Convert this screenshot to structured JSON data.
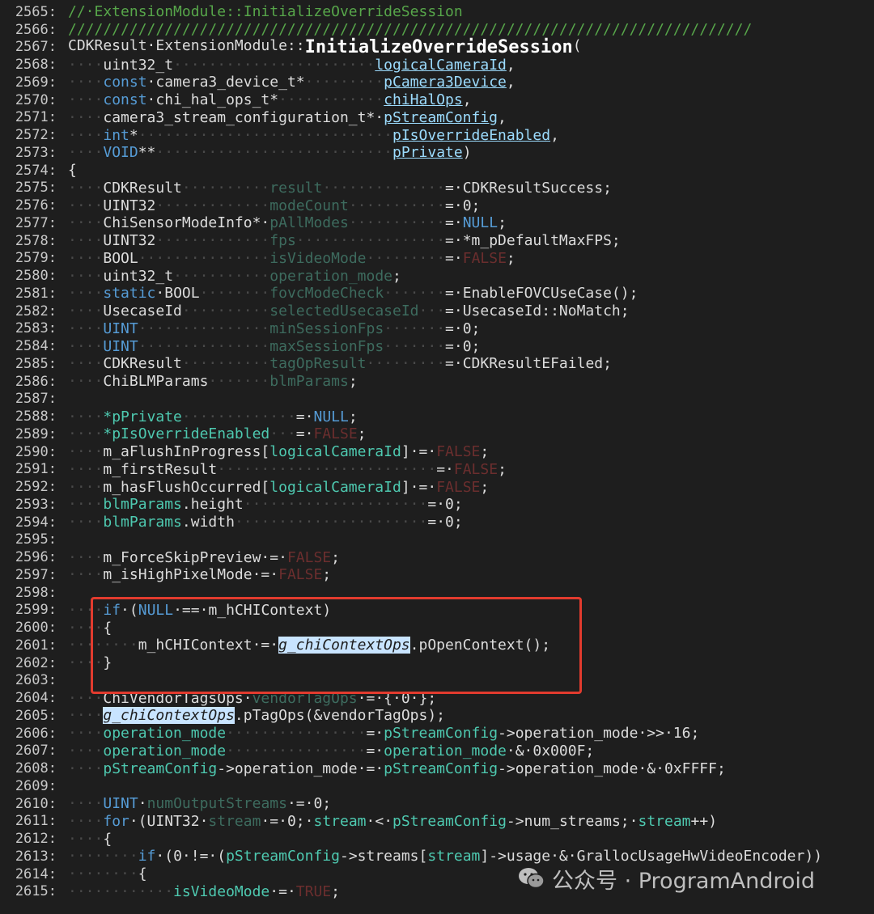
{
  "editor": {
    "lines": [
      {
        "n": "2565:",
        "tokens": [
          [
            "cm",
            "//·ExtensionModule::InitializeOverrideSession"
          ]
        ]
      },
      {
        "n": "2566:",
        "tokens": [
          [
            "cm",
            "//////////////////////////////////////////////////////////////////////////////"
          ]
        ]
      },
      {
        "n": "2567:",
        "tokens": [
          [
            "txt",
            "CDKResult·ExtensionModule::"
          ],
          [
            "fn",
            "InitializeOverrideSession"
          ],
          [
            "txt",
            "("
          ]
        ]
      },
      {
        "n": "2568:",
        "tokens": [
          [
            "ws",
            "····"
          ],
          [
            "ty",
            "uint32_t"
          ],
          [
            "ws",
            "·······················"
          ],
          [
            "param",
            "logicalCameraId"
          ],
          [
            "txt",
            ","
          ]
        ]
      },
      {
        "n": "2569:",
        "tokens": [
          [
            "ws",
            "····"
          ],
          [
            "kw",
            "const"
          ],
          [
            "txt",
            "·camera3_device_t*"
          ],
          [
            "ws",
            "·········"
          ],
          [
            "param",
            "pCamera3Device"
          ],
          [
            "txt",
            ","
          ]
        ]
      },
      {
        "n": "2570:",
        "tokens": [
          [
            "ws",
            "····"
          ],
          [
            "kw",
            "const"
          ],
          [
            "txt",
            "·chi_hal_ops_t*"
          ],
          [
            "ws",
            "············"
          ],
          [
            "param",
            "chiHalOps"
          ],
          [
            "txt",
            ","
          ]
        ]
      },
      {
        "n": "2571:",
        "tokens": [
          [
            "ws",
            "····"
          ],
          [
            "txt",
            "camera3_stream_configuration_t*·"
          ],
          [
            "param",
            "pStreamConfig"
          ],
          [
            "txt",
            ","
          ]
        ]
      },
      {
        "n": "2572:",
        "tokens": [
          [
            "ws",
            "····"
          ],
          [
            "kw",
            "int"
          ],
          [
            "txt",
            "*"
          ],
          [
            "ws",
            "·····························"
          ],
          [
            "param",
            "pIsOverrideEnabled"
          ],
          [
            "txt",
            ","
          ]
        ]
      },
      {
        "n": "2573:",
        "tokens": [
          [
            "ws",
            "····"
          ],
          [
            "kw",
            "VOID"
          ],
          [
            "txt",
            "**"
          ],
          [
            "ws",
            "···························"
          ],
          [
            "param",
            "pPrivate"
          ],
          [
            "txt",
            ")"
          ]
        ]
      },
      {
        "n": "2574:",
        "tokens": [
          [
            "txt",
            "{"
          ]
        ]
      },
      {
        "n": "2575:",
        "tokens": [
          [
            "ws",
            "····"
          ],
          [
            "txt",
            "CDKResult"
          ],
          [
            "ws",
            "··········"
          ],
          [
            "dim",
            "result"
          ],
          [
            "ws",
            "··············"
          ],
          [
            "txt",
            "=·CDKResultSuccess;"
          ]
        ]
      },
      {
        "n": "2576:",
        "tokens": [
          [
            "ws",
            "····"
          ],
          [
            "txt",
            "UINT32"
          ],
          [
            "ws",
            "·············"
          ],
          [
            "dim",
            "modeCount"
          ],
          [
            "ws",
            "···········"
          ],
          [
            "txt",
            "=·0;"
          ]
        ]
      },
      {
        "n": "2577:",
        "tokens": [
          [
            "ws",
            "····"
          ],
          [
            "txt",
            "ChiSensorModeInfo*·"
          ],
          [
            "dim",
            "pAllModes"
          ],
          [
            "ws",
            "···········"
          ],
          [
            "txt",
            "=·"
          ],
          [
            "kw",
            "NULL"
          ],
          [
            "txt",
            ";"
          ]
        ]
      },
      {
        "n": "2578:",
        "tokens": [
          [
            "ws",
            "····"
          ],
          [
            "txt",
            "UINT32"
          ],
          [
            "ws",
            "·············"
          ],
          [
            "dim",
            "fps"
          ],
          [
            "ws",
            "·················"
          ],
          [
            "txt",
            "=·*m_pDefaultMaxFPS;"
          ]
        ]
      },
      {
        "n": "2579:",
        "tokens": [
          [
            "ws",
            "····"
          ],
          [
            "txt",
            "BOOL"
          ],
          [
            "ws",
            "···············"
          ],
          [
            "dim",
            "isVideoMode"
          ],
          [
            "ws",
            "·········"
          ],
          [
            "txt",
            "=·"
          ],
          [
            "red",
            "FALSE"
          ],
          [
            "txt",
            ";"
          ]
        ]
      },
      {
        "n": "2580:",
        "tokens": [
          [
            "ws",
            "····"
          ],
          [
            "txt",
            "uint32_t"
          ],
          [
            "ws",
            "···········"
          ],
          [
            "dim",
            "operation_mode"
          ],
          [
            "txt",
            ";"
          ]
        ]
      },
      {
        "n": "2581:",
        "tokens": [
          [
            "ws",
            "····"
          ],
          [
            "kw",
            "static"
          ],
          [
            "txt",
            "·BOOL"
          ],
          [
            "ws",
            "········"
          ],
          [
            "dim",
            "fovcModeCheck"
          ],
          [
            "ws",
            "·······"
          ],
          [
            "txt",
            "=·EnableFOVCUseCase();"
          ]
        ]
      },
      {
        "n": "2582:",
        "tokens": [
          [
            "ws",
            "····"
          ],
          [
            "txt",
            "UsecaseId"
          ],
          [
            "ws",
            "··········"
          ],
          [
            "dim",
            "selectedUsecaseId"
          ],
          [
            "ws",
            "···"
          ],
          [
            "txt",
            "=·UsecaseId::NoMatch;"
          ]
        ]
      },
      {
        "n": "2583:",
        "tokens": [
          [
            "ws",
            "····"
          ],
          [
            "kw",
            "UINT"
          ],
          [
            "ws",
            "···············"
          ],
          [
            "dim",
            "minSessionFps"
          ],
          [
            "ws",
            "·······"
          ],
          [
            "txt",
            "=·0;"
          ]
        ]
      },
      {
        "n": "2584:",
        "tokens": [
          [
            "ws",
            "····"
          ],
          [
            "kw",
            "UINT"
          ],
          [
            "ws",
            "···············"
          ],
          [
            "dim",
            "maxSessionFps"
          ],
          [
            "ws",
            "·······"
          ],
          [
            "txt",
            "=·0;"
          ]
        ]
      },
      {
        "n": "2585:",
        "tokens": [
          [
            "ws",
            "····"
          ],
          [
            "txt",
            "CDKResult"
          ],
          [
            "ws",
            "··········"
          ],
          [
            "dim",
            "tagOpResult"
          ],
          [
            "ws",
            "·········"
          ],
          [
            "txt",
            "=·CDKResultEFailed;"
          ]
        ]
      },
      {
        "n": "2586:",
        "tokens": [
          [
            "ws",
            "····"
          ],
          [
            "txt",
            "ChiBLMParams"
          ],
          [
            "ws",
            "·······"
          ],
          [
            "dim",
            "blmParams"
          ],
          [
            "txt",
            ";"
          ]
        ]
      },
      {
        "n": "2587:",
        "tokens": []
      },
      {
        "n": "2588:",
        "tokens": [
          [
            "ws",
            "····"
          ],
          [
            "va",
            "*pPrivate"
          ],
          [
            "ws",
            "·············"
          ],
          [
            "txt",
            "=·"
          ],
          [
            "kw",
            "NULL"
          ],
          [
            "txt",
            ";"
          ]
        ]
      },
      {
        "n": "2589:",
        "tokens": [
          [
            "ws",
            "····"
          ],
          [
            "va",
            "*pIsOverrideEnabled"
          ],
          [
            "ws",
            "···"
          ],
          [
            "txt",
            "=·"
          ],
          [
            "red",
            "FALSE"
          ],
          [
            "txt",
            ";"
          ]
        ]
      },
      {
        "n": "2590:",
        "tokens": [
          [
            "ws",
            "····"
          ],
          [
            "txt",
            "m_aFlushInProgress["
          ],
          [
            "va",
            "logicalCameraId"
          ],
          [
            "txt",
            "]·=·"
          ],
          [
            "red",
            "FALSE"
          ],
          [
            "txt",
            ";"
          ]
        ]
      },
      {
        "n": "2591:",
        "tokens": [
          [
            "ws",
            "····"
          ],
          [
            "txt",
            "m_firstResult"
          ],
          [
            "ws",
            "·························"
          ],
          [
            "txt",
            "=·"
          ],
          [
            "red",
            "FALSE"
          ],
          [
            "txt",
            ";"
          ]
        ]
      },
      {
        "n": "2592:",
        "tokens": [
          [
            "ws",
            "····"
          ],
          [
            "txt",
            "m_hasFlushOccurred["
          ],
          [
            "va",
            "logicalCameraId"
          ],
          [
            "txt",
            "]·=·"
          ],
          [
            "red",
            "FALSE"
          ],
          [
            "txt",
            ";"
          ]
        ]
      },
      {
        "n": "2593:",
        "tokens": [
          [
            "ws",
            "····"
          ],
          [
            "va",
            "blmParams"
          ],
          [
            "txt",
            ".height"
          ],
          [
            "ws",
            "·····················"
          ],
          [
            "txt",
            "=·0;"
          ]
        ]
      },
      {
        "n": "2594:",
        "tokens": [
          [
            "ws",
            "····"
          ],
          [
            "va",
            "blmParams"
          ],
          [
            "txt",
            ".width"
          ],
          [
            "ws",
            "······················"
          ],
          [
            "txt",
            "=·0;"
          ]
        ]
      },
      {
        "n": "2595:",
        "tokens": []
      },
      {
        "n": "2596:",
        "tokens": [
          [
            "ws",
            "····"
          ],
          [
            "txt",
            "m_ForceSkipPreview·=·"
          ],
          [
            "red",
            "FALSE"
          ],
          [
            "txt",
            ";"
          ]
        ]
      },
      {
        "n": "2597:",
        "tokens": [
          [
            "ws",
            "····"
          ],
          [
            "txt",
            "m_isHighPixelMode·=·"
          ],
          [
            "red",
            "FALSE"
          ],
          [
            "txt",
            ";"
          ]
        ]
      },
      {
        "n": "2598:",
        "tokens": []
      },
      {
        "n": "2599:",
        "tokens": [
          [
            "ws",
            "····"
          ],
          [
            "kw",
            "if"
          ],
          [
            "txt",
            "·("
          ],
          [
            "kw",
            "NULL"
          ],
          [
            "txt",
            "·==·m_hCHIContext)"
          ]
        ]
      },
      {
        "n": "2600:",
        "tokens": [
          [
            "ws",
            "····"
          ],
          [
            "txt",
            "{"
          ]
        ]
      },
      {
        "n": "2601:",
        "tokens": [
          [
            "ws",
            "········"
          ],
          [
            "txt",
            "m_hCHIContext·=·"
          ],
          [
            "hl",
            "g_chiContextOps"
          ],
          [
            "txt",
            ".pOpenContext();"
          ]
        ]
      },
      {
        "n": "2602:",
        "tokens": [
          [
            "ws",
            "····"
          ],
          [
            "txt",
            "}"
          ]
        ]
      },
      {
        "n": "2603:",
        "tokens": []
      },
      {
        "n": "2604:",
        "tokens": [
          [
            "ws",
            "····"
          ],
          [
            "txt",
            "ChiVendorTagsOps·"
          ],
          [
            "dim",
            "vendorTagOps"
          ],
          [
            "txt",
            "·=·{·0·};"
          ]
        ]
      },
      {
        "n": "2605:",
        "tokens": [
          [
            "ws",
            "····"
          ],
          [
            "hl",
            "g_chiContextOps"
          ],
          [
            "txt",
            ".pTagOps(&vendorTagOps);"
          ]
        ]
      },
      {
        "n": "2606:",
        "tokens": [
          [
            "ws",
            "····"
          ],
          [
            "va",
            "operation_mode"
          ],
          [
            "ws",
            "················"
          ],
          [
            "txt",
            "=·"
          ],
          [
            "va",
            "pStreamConfig"
          ],
          [
            "txt",
            "->operation_mode·>>·16;"
          ]
        ]
      },
      {
        "n": "2607:",
        "tokens": [
          [
            "ws",
            "····"
          ],
          [
            "va",
            "operation_mode"
          ],
          [
            "ws",
            "················"
          ],
          [
            "txt",
            "=·"
          ],
          [
            "va",
            "operation_mode"
          ],
          [
            "txt",
            "·&·0x000F;"
          ]
        ]
      },
      {
        "n": "2608:",
        "tokens": [
          [
            "ws",
            "····"
          ],
          [
            "va",
            "pStreamConfig"
          ],
          [
            "txt",
            "->operation_mode·=·"
          ],
          [
            "va",
            "pStreamConfig"
          ],
          [
            "txt",
            "->operation_mode·&·0xFFFF;"
          ]
        ]
      },
      {
        "n": "2609:",
        "tokens": []
      },
      {
        "n": "2610:",
        "tokens": [
          [
            "ws",
            "····"
          ],
          [
            "kw",
            "UINT"
          ],
          [
            "txt",
            "·"
          ],
          [
            "dim",
            "numOutputStreams"
          ],
          [
            "txt",
            "·=·0;"
          ]
        ]
      },
      {
        "n": "2611:",
        "tokens": [
          [
            "ws",
            "····"
          ],
          [
            "kw",
            "for"
          ],
          [
            "txt",
            "·(UINT32·"
          ],
          [
            "dim",
            "stream"
          ],
          [
            "txt",
            "·=·0;·"
          ],
          [
            "va",
            "stream"
          ],
          [
            "txt",
            "·<·"
          ],
          [
            "va",
            "pStreamConfig"
          ],
          [
            "txt",
            "->num_streams;·"
          ],
          [
            "va",
            "stream"
          ],
          [
            "txt",
            "++)"
          ]
        ]
      },
      {
        "n": "2612:",
        "tokens": [
          [
            "ws",
            "····"
          ],
          [
            "txt",
            "{"
          ]
        ]
      },
      {
        "n": "2613:",
        "tokens": [
          [
            "ws",
            "········"
          ],
          [
            "kw",
            "if"
          ],
          [
            "txt",
            "·(0·!=·("
          ],
          [
            "va",
            "pStreamConfig"
          ],
          [
            "txt",
            "->streams["
          ],
          [
            "va",
            "stream"
          ],
          [
            "txt",
            "]->usage·&·GrallocUsageHwVideoEncoder))"
          ]
        ]
      },
      {
        "n": "2614:",
        "tokens": [
          [
            "ws",
            "········"
          ],
          [
            "txt",
            "{"
          ]
        ]
      },
      {
        "n": "2615:",
        "tokens": [
          [
            "ws",
            "············"
          ],
          [
            "va",
            "isVideoMode"
          ],
          [
            "txt",
            "·=·"
          ],
          [
            "red",
            "TRUE"
          ],
          [
            "txt",
            ";"
          ]
        ]
      }
    ]
  },
  "watermark": {
    "text": "公众号 · ProgramAndroid",
    "icon": "wechat-icon"
  },
  "colors": {
    "highlight_box": "#e23b2e",
    "background": "#1e1e1e"
  }
}
